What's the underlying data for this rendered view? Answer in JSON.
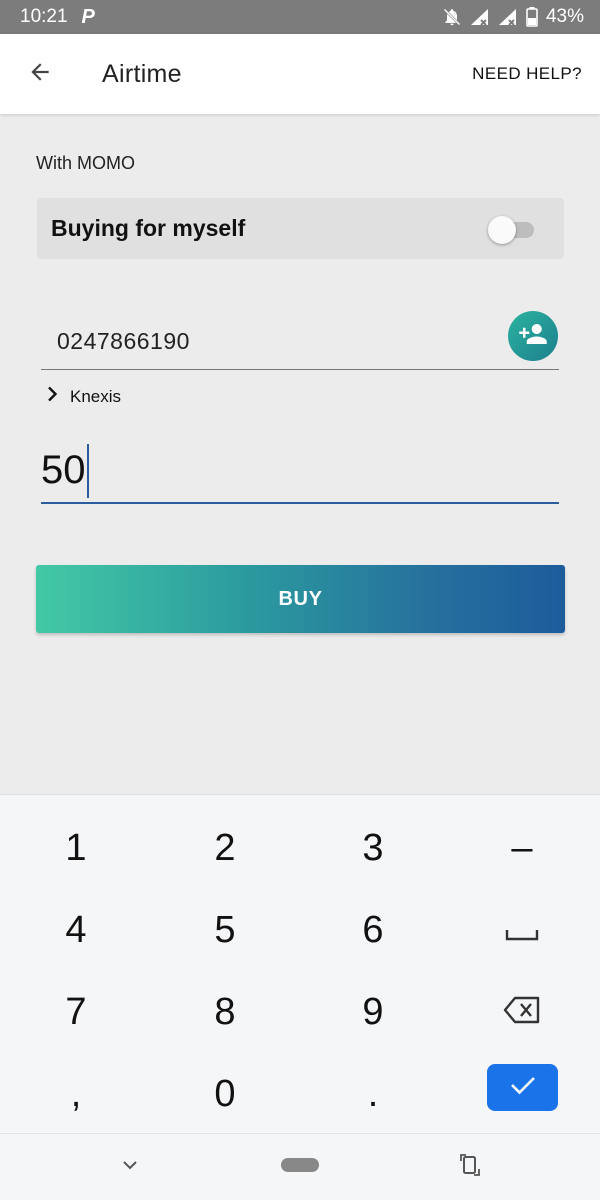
{
  "status_bar": {
    "time": "10:21",
    "notification_icon": "P",
    "battery": "43%"
  },
  "app_bar": {
    "title": "Airtime",
    "help": "NEED HELP?"
  },
  "payment_method": "With MOMO",
  "toggle": {
    "label": "Buying for myself",
    "on": false
  },
  "phone": {
    "value": "0247866190"
  },
  "network": {
    "name": "Knexis"
  },
  "amount": {
    "value": "50"
  },
  "buy_button": {
    "label": "BUY"
  },
  "keyboard": {
    "keys": [
      "1",
      "2",
      "3",
      "–",
      "4",
      "5",
      "6",
      "␣",
      "7",
      "8",
      "9",
      "⌫",
      ",",
      "0",
      ".",
      "✓"
    ]
  },
  "colors": {
    "accent_blue": "#1a73e8",
    "gradient_start": "#43c9a5",
    "gradient_end": "#1d5c9c"
  }
}
